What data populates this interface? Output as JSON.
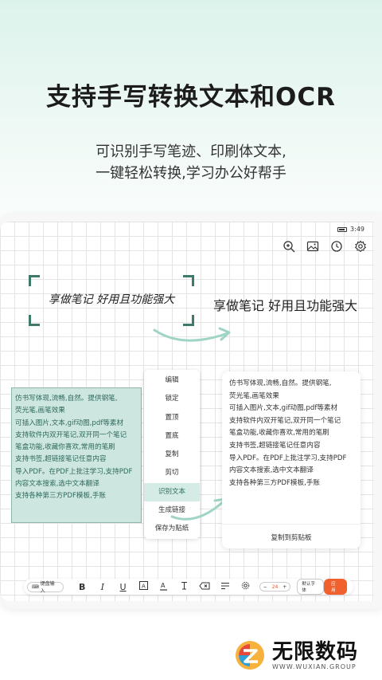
{
  "hero": {
    "title": "支持手写转换文本和OCR",
    "subtitle_line1": "可识别手写笔迹、印刷体文本,",
    "subtitle_line2": "一键轻松转换,学习办公好帮手"
  },
  "statusbar": {
    "time": "3:49"
  },
  "top_icons": [
    "zoom-icon",
    "image-icon",
    "clock-icon",
    "gear-icon"
  ],
  "handwriting": {
    "handwritten_text": "享做笔记 好用且功能强大",
    "converted_text": "享做笔记 好用且功能强大"
  },
  "green_note": {
    "lines": [
      "仿书写体现,流畅,自然。提供钢笔,",
      "荧光笔,画笔效果",
      "可插入图片,文本,gif动图,pdf等素材",
      "支持软件内双开笔记,双开同一个笔记",
      "笔盒功能,收藏你喜欢,常用的笔刷",
      "支持书签,超链接笔记任意内容",
      "导入PDF。在PDF上批注学习,支持PDF",
      "内容文本搜索,选中文本翻译",
      "支持各种第三方PDF模板,手账"
    ]
  },
  "context_menu": {
    "items": [
      "编辑",
      "锁定",
      "置顶",
      "置底",
      "复制",
      "剪切",
      "识别文本",
      "生成链接",
      "保存为贴纸"
    ],
    "active_index": 6
  },
  "result_card": {
    "lines": [
      "仿书写体现,流畅,自然。提供钢笔,",
      "荧光笔,画笔效果",
      "可插入图片,文本,gif动图,pdf等素材",
      "支持软件内双开笔记,双开同一个笔记",
      "笔盒功能,收藏你喜欢,常用的笔刷",
      "支持书签,超链接笔记任意内容",
      "导入PDF。在PDF上批注学习,支持PDF",
      "内容文本搜索,选中文本翻译",
      "支持各种第三方PDF模板,手账"
    ],
    "copy_label": "复制到剪贴板"
  },
  "toolbar": {
    "keyboard_input": "键盘输入",
    "bold": "B",
    "italic": "I",
    "underline": "U",
    "font_size": "24",
    "font_button": "默认字体",
    "apply_button": "应用"
  },
  "watermark": {
    "name": "无限数码",
    "url": "WWW.WUXIAN.GROUP"
  },
  "colors": {
    "accent_green": "#3d7a6b",
    "highlight_green": "#cde6df",
    "apply_orange": "#f0612d"
  }
}
